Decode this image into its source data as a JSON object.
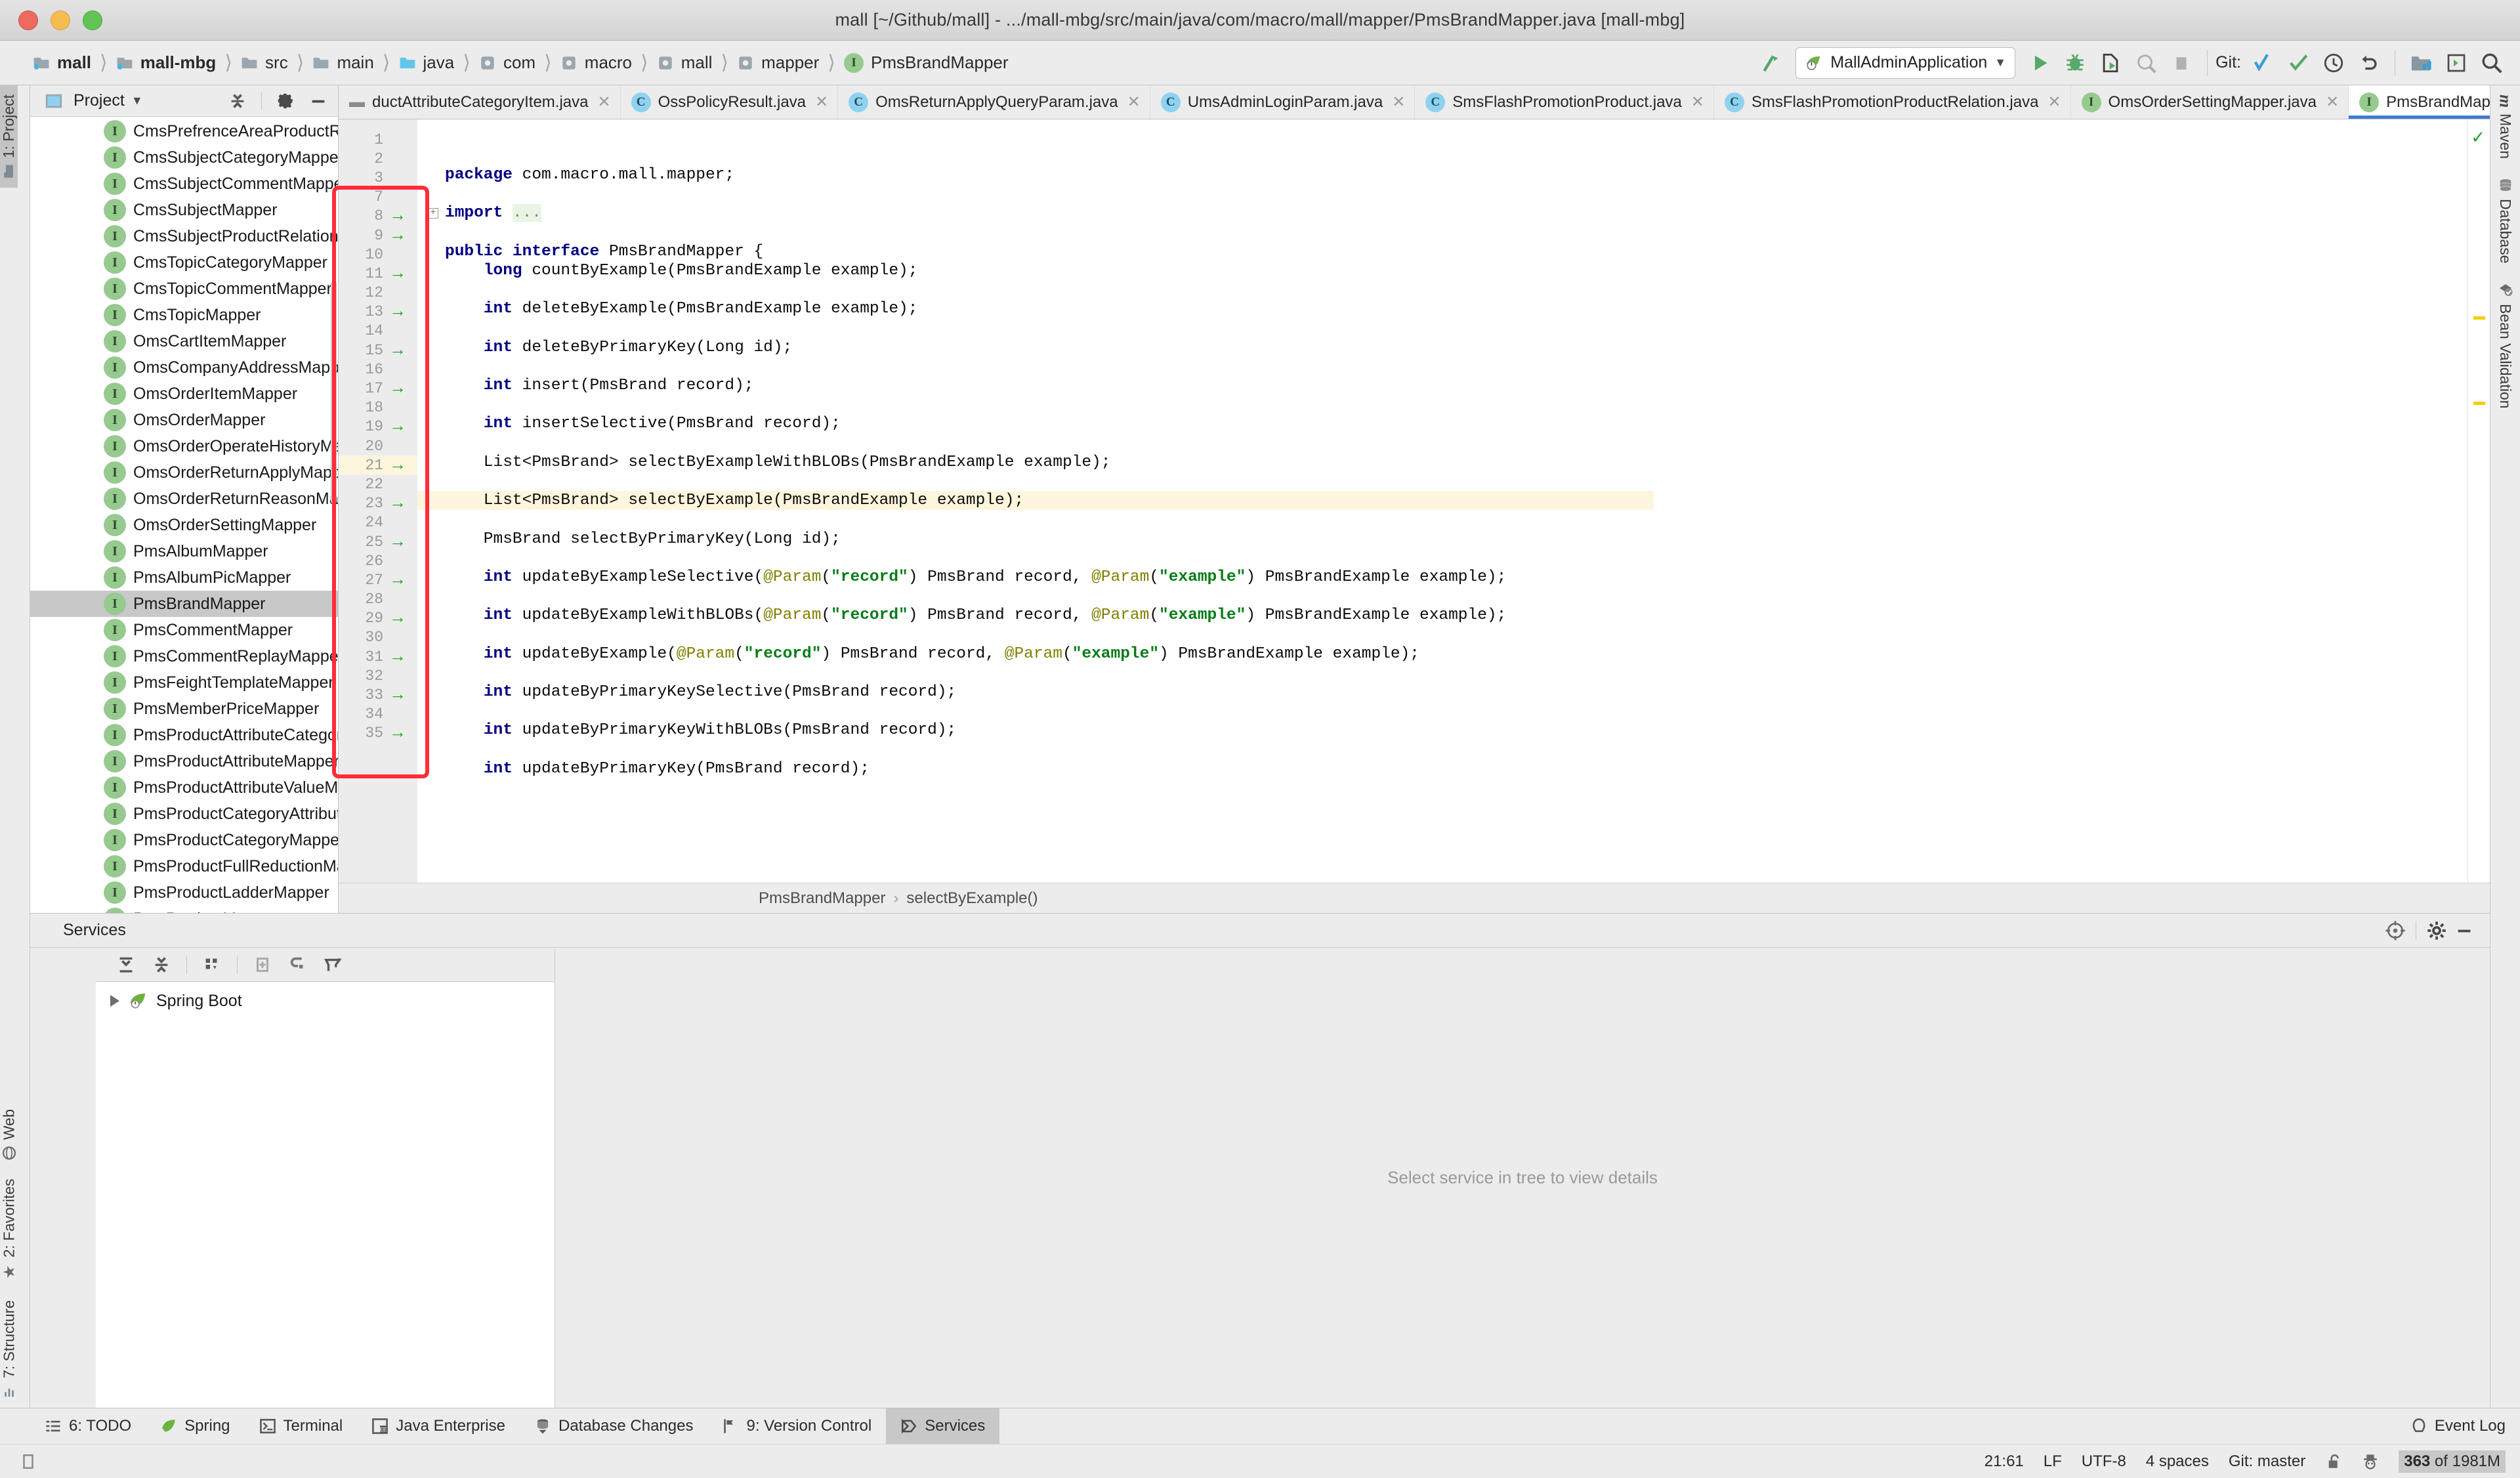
{
  "window": {
    "title": "mall [~/Github/mall] - .../mall-mbg/src/main/java/com/macro/mall/mapper/PmsBrandMapper.java [mall-mbg]"
  },
  "navbar": {
    "breadcrumbs": [
      {
        "label": "mall",
        "icon": "module-icon",
        "bold": true
      },
      {
        "label": "mall-mbg",
        "icon": "module-icon",
        "bold": true
      },
      {
        "label": "src",
        "icon": "folder-icon",
        "bold": false
      },
      {
        "label": "main",
        "icon": "folder-icon",
        "bold": false
      },
      {
        "label": "java",
        "icon": "source-folder-icon",
        "bold": false
      },
      {
        "label": "com",
        "icon": "package-icon",
        "bold": false
      },
      {
        "label": "macro",
        "icon": "package-icon",
        "bold": false
      },
      {
        "label": "mall",
        "icon": "package-icon",
        "bold": false
      },
      {
        "label": "mapper",
        "icon": "package-icon",
        "bold": false
      },
      {
        "label": "PmsBrandMapper",
        "icon": "interface-icon",
        "bold": false
      }
    ],
    "run_configuration": "MallAdminApplication",
    "git_label": "Git:",
    "icons": [
      "build-icon",
      "run-icon",
      "debug-icon",
      "run-coverage-icon",
      "profile-icon",
      "stop-icon",
      "git-update-icon",
      "git-commit-icon",
      "git-history-icon",
      "git-rollback-icon",
      "project-structure-icon",
      "select-in-icon",
      "search-everywhere-icon"
    ]
  },
  "left_strip": {
    "top": [
      {
        "label": "1: Project",
        "active": true
      }
    ],
    "bottom": [
      {
        "label": "7: Structure",
        "active": false
      },
      {
        "label": "2: Favorites",
        "active": false
      },
      {
        "label": "Web",
        "active": false
      }
    ]
  },
  "right_strip": {
    "items": [
      {
        "label": "Maven",
        "icon": "maven-icon"
      },
      {
        "label": "Database",
        "icon": "database-icon"
      },
      {
        "label": "Bean Validation",
        "icon": "bean-validation-icon"
      }
    ]
  },
  "project_panel": {
    "title": "Project",
    "tree": [
      {
        "label": "CmsPrefrenceAreaProductRela",
        "selected": false
      },
      {
        "label": "CmsSubjectCategoryMapper",
        "selected": false
      },
      {
        "label": "CmsSubjectCommentMapper",
        "selected": false
      },
      {
        "label": "CmsSubjectMapper",
        "selected": false
      },
      {
        "label": "CmsSubjectProductRelationM",
        "selected": false
      },
      {
        "label": "CmsTopicCategoryMapper",
        "selected": false
      },
      {
        "label": "CmsTopicCommentMapper",
        "selected": false
      },
      {
        "label": "CmsTopicMapper",
        "selected": false
      },
      {
        "label": "OmsCartItemMapper",
        "selected": false
      },
      {
        "label": "OmsCompanyAddressMapper",
        "selected": false
      },
      {
        "label": "OmsOrderItemMapper",
        "selected": false
      },
      {
        "label": "OmsOrderMapper",
        "selected": false
      },
      {
        "label": "OmsOrderOperateHistoryMap",
        "selected": false
      },
      {
        "label": "OmsOrderReturnApplyMapper",
        "selected": false
      },
      {
        "label": "OmsOrderReturnReasonMappe",
        "selected": false
      },
      {
        "label": "OmsOrderSettingMapper",
        "selected": false
      },
      {
        "label": "PmsAlbumMapper",
        "selected": false
      },
      {
        "label": "PmsAlbumPicMapper",
        "selected": false
      },
      {
        "label": "PmsBrandMapper",
        "selected": true
      },
      {
        "label": "PmsCommentMapper",
        "selected": false
      },
      {
        "label": "PmsCommentReplayMapper",
        "selected": false
      },
      {
        "label": "PmsFeightTemplateMapper",
        "selected": false
      },
      {
        "label": "PmsMemberPriceMapper",
        "selected": false
      },
      {
        "label": "PmsProductAttributeCategoryM",
        "selected": false
      },
      {
        "label": "PmsProductAttributeMapper",
        "selected": false
      },
      {
        "label": "PmsProductAttributeValueMap",
        "selected": false
      },
      {
        "label": "PmsProductCategoryAttributeR",
        "selected": false
      },
      {
        "label": "PmsProductCategoryMapper",
        "selected": false
      },
      {
        "label": "PmsProductFullReductionMapp",
        "selected": false
      },
      {
        "label": "PmsProductLadderMapper",
        "selected": false
      },
      {
        "label": "PmsProductMapper",
        "selected": false
      }
    ]
  },
  "editor": {
    "tabs": [
      {
        "label": "ductAttributeCategoryItem.java",
        "kind": "class",
        "active": false,
        "truncated": true
      },
      {
        "label": "OssPolicyResult.java",
        "kind": "class",
        "active": false
      },
      {
        "label": "OmsReturnApplyQueryParam.java",
        "kind": "class",
        "active": false
      },
      {
        "label": "UmsAdminLoginParam.java",
        "kind": "class",
        "active": false
      },
      {
        "label": "SmsFlashPromotionProduct.java",
        "kind": "class",
        "active": false
      },
      {
        "label": "SmsFlashPromotionProductRelation.java",
        "kind": "class",
        "active": false
      },
      {
        "label": "OmsOrderSettingMapper.java",
        "kind": "interface",
        "active": false
      },
      {
        "label": "PmsBrandMapper.java",
        "kind": "interface",
        "active": true
      }
    ],
    "tabs_overflow_count": "3",
    "breadcrumb": {
      "class": "PmsBrandMapper",
      "member": "selectByExample()",
      "separator": "›"
    },
    "lines": [
      {
        "num": "1",
        "arrow": false,
        "html": "<span class=\"kw\">package</span> com.macro.mall.mapper;"
      },
      {
        "num": "2",
        "arrow": false,
        "html": ""
      },
      {
        "num": "3",
        "arrow": false,
        "fold": true,
        "html": "<span class=\"kw\">import</span> <span class=\"dots\">...</span>"
      },
      {
        "num": "7",
        "arrow": false,
        "html": ""
      },
      {
        "num": "8",
        "arrow": true,
        "html": "<span class=\"kw\">public interface</span> PmsBrandMapper {"
      },
      {
        "num": "9",
        "arrow": true,
        "html": "    <span class=\"kw\">long</span> countByExample(PmsBrandExample example);"
      },
      {
        "num": "10",
        "arrow": false,
        "html": ""
      },
      {
        "num": "11",
        "arrow": true,
        "html": "    <span class=\"kw\">int</span> deleteByExample(PmsBrandExample example);"
      },
      {
        "num": "12",
        "arrow": false,
        "html": ""
      },
      {
        "num": "13",
        "arrow": true,
        "html": "    <span class=\"kw\">int</span> deleteByPrimaryKey(Long id);"
      },
      {
        "num": "14",
        "arrow": false,
        "html": ""
      },
      {
        "num": "15",
        "arrow": true,
        "html": "    <span class=\"kw\">int</span> insert(PmsBrand record);"
      },
      {
        "num": "16",
        "arrow": false,
        "html": ""
      },
      {
        "num": "17",
        "arrow": true,
        "html": "    <span class=\"kw\">int</span> insertSelective(PmsBrand record);"
      },
      {
        "num": "18",
        "arrow": false,
        "html": ""
      },
      {
        "num": "19",
        "arrow": true,
        "html": "    List&lt;PmsBrand&gt; selectByExampleWithBLOBs(PmsBrandExample example);"
      },
      {
        "num": "20",
        "arrow": false,
        "html": ""
      },
      {
        "num": "21",
        "arrow": true,
        "hl": true,
        "html": "    List&lt;PmsBrand&gt; selectByExample(PmsBrandExample example);"
      },
      {
        "num": "22",
        "arrow": false,
        "html": ""
      },
      {
        "num": "23",
        "arrow": true,
        "html": "    PmsBrand selectByPrimaryKey(Long id);"
      },
      {
        "num": "24",
        "arrow": false,
        "html": ""
      },
      {
        "num": "25",
        "arrow": true,
        "html": "    <span class=\"kw\">int</span> updateByExampleSelective(<span class=\"ann\">@Param</span>(<span class=\"str\">\"record\"</span>) PmsBrand record, <span class=\"ann\">@Param</span>(<span class=\"str\">\"example\"</span>) PmsBrandExample example);"
      },
      {
        "num": "26",
        "arrow": false,
        "html": ""
      },
      {
        "num": "27",
        "arrow": true,
        "html": "    <span class=\"kw\">int</span> updateByExampleWithBLOBs(<span class=\"ann\">@Param</span>(<span class=\"str\">\"record\"</span>) PmsBrand record, <span class=\"ann\">@Param</span>(<span class=\"str\">\"example\"</span>) PmsBrandExample example);"
      },
      {
        "num": "28",
        "arrow": false,
        "html": ""
      },
      {
        "num": "29",
        "arrow": true,
        "html": "    <span class=\"kw\">int</span> updateByExample(<span class=\"ann\">@Param</span>(<span class=\"str\">\"record\"</span>) PmsBrand record, <span class=\"ann\">@Param</span>(<span class=\"str\">\"example\"</span>) PmsBrandExample example);"
      },
      {
        "num": "30",
        "arrow": false,
        "html": ""
      },
      {
        "num": "31",
        "arrow": true,
        "html": "    <span class=\"kw\">int</span> updateByPrimaryKeySelective(PmsBrand record);"
      },
      {
        "num": "32",
        "arrow": false,
        "html": ""
      },
      {
        "num": "33",
        "arrow": true,
        "html": "    <span class=\"kw\">int</span> updateByPrimaryKeyWithBLOBs(PmsBrand record);"
      },
      {
        "num": "34",
        "arrow": false,
        "html": ""
      },
      {
        "num": "35",
        "arrow": true,
        "html": "    <span class=\"kw\">int</span> updateByPrimaryKey(PmsBrand record);"
      }
    ]
  },
  "services": {
    "title": "Services",
    "tree_root": "Spring Boot",
    "empty_text": "Select service in tree to view details",
    "toolbar_icons": [
      "expand-all-icon",
      "collapse-all-icon",
      "group-by-icon",
      "add-service-icon",
      "attach-icon",
      "filter-icon"
    ],
    "header_icons": [
      "settings-gear-icon",
      "hide-icon"
    ],
    "locate-icon": "locate-icon"
  },
  "bottom_bar": {
    "buttons": [
      {
        "label": "6: TODO",
        "icon": "todo-icon",
        "active": false,
        "mnemonic": "6"
      },
      {
        "label": "Spring",
        "icon": "spring-icon",
        "active": false
      },
      {
        "label": "Terminal",
        "icon": "terminal-icon",
        "active": false
      },
      {
        "label": "Java Enterprise",
        "icon": "java-enterprise-icon",
        "active": false
      },
      {
        "label": "Database Changes",
        "icon": "database-changes-icon",
        "active": false
      },
      {
        "label": "9: Version Control",
        "icon": "version-control-icon",
        "active": false,
        "mnemonic": "9"
      },
      {
        "label": "Services",
        "icon": "services-icon",
        "active": true
      }
    ],
    "event_log": "Event Log"
  },
  "status_bar": {
    "caret_position": "21:61",
    "line_separator": "LF",
    "encoding": "UTF-8",
    "indent": "4 spaces",
    "branch": "Git: master",
    "memory_used": "363",
    "memory_total": " of 1981M",
    "lock_icon": "unlocked-icon",
    "inspector_icon": "inspector-hat-icon"
  },
  "colors": {
    "accent_blue": "#3d7dd4",
    "annotation_red": "#ff2c38",
    "interface_green": "#96ca8f",
    "class_blue": "#8fd2ef",
    "keyword": "#00007f",
    "string": "#067d17",
    "annotation_yellow": "#808000",
    "highlight_line": "#fdf6dd"
  }
}
